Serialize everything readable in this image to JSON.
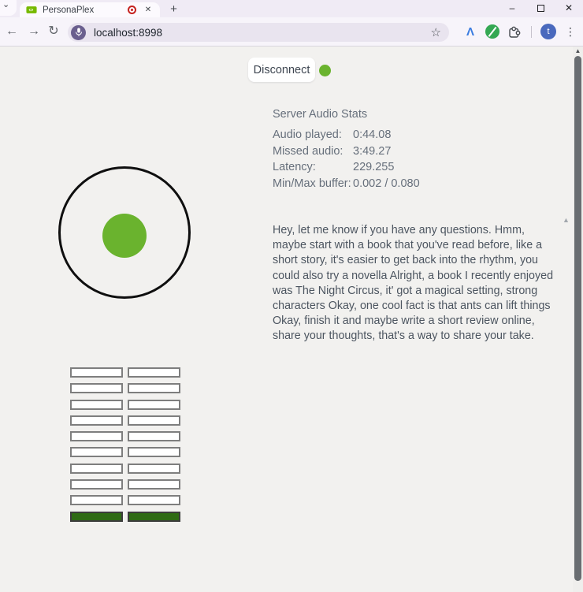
{
  "browser": {
    "tab_title": "PersonaPlex",
    "url": "localhost:8998",
    "profile_initial": "t",
    "glyphs": {
      "tab_search_chevron": "⌄",
      "tab_close": "✕",
      "new_tab": "+",
      "minimize": "–",
      "window_close": "✕",
      "back": "←",
      "forward": "→",
      "reload": "↻",
      "bookmark_star": "☆",
      "extension_arrow": "Λ",
      "menu_dots": "⋮",
      "scroll_up_arrow": "▲"
    }
  },
  "app": {
    "disconnect_label": "Disconnect",
    "stats": {
      "title": "Server Audio Stats",
      "rows": [
        {
          "label": "Audio played:",
          "value": "0:44.08"
        },
        {
          "label": "Missed audio:",
          "value": "3:49.27"
        },
        {
          "label": "Latency:",
          "value": "229.255"
        },
        {
          "label": "Min/Max buffer:",
          "value": "0.002 / 0.080"
        }
      ]
    },
    "transcript": "Hey, let me know if you have any questions. Hmm, maybe start with a book that you've read before, like a short story, it's easier to get back into the rhythm, you could also try a novella Alright, a book I recently enjoyed was The Night Circus, it' got a magical setting, strong characters Okay, one cool fact is that ants can lift things Okay, finish it and maybe write a short review online, share your thoughts, that's a way to share your take.",
    "buffer_grid": {
      "rows": 10,
      "cols": 2,
      "filled_rows": [
        9
      ]
    },
    "colors": {
      "status_green": "#6ab32e",
      "buffer_filled_green": "#2f6b14"
    }
  }
}
